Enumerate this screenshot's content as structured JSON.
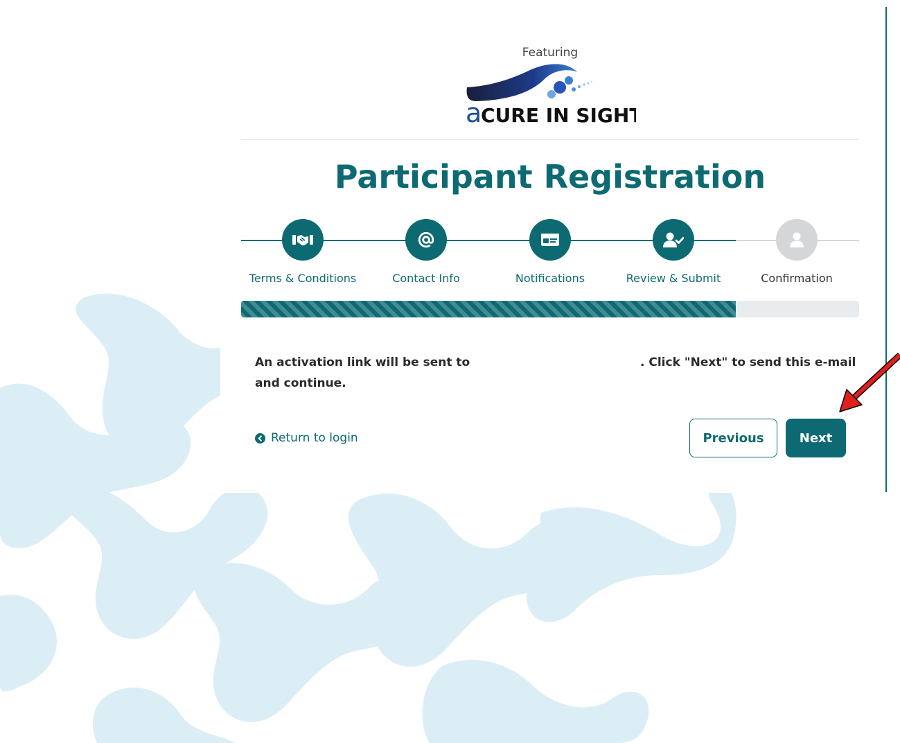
{
  "header": {
    "featuring": "Featuring",
    "brand": "CURE IN SIGHT"
  },
  "page": {
    "title": "Participant Registration"
  },
  "steps": [
    {
      "label": "Terms & Conditions",
      "icon": "handshake-icon",
      "state": "complete"
    },
    {
      "label": "Contact Info",
      "icon": "at-sign-icon",
      "state": "complete"
    },
    {
      "label": "Notifications",
      "icon": "id-card-icon",
      "state": "complete"
    },
    {
      "label": "Review & Submit",
      "icon": "user-check-icon",
      "state": "current"
    },
    {
      "label": "Confirmation",
      "icon": "user-icon",
      "state": "pending"
    }
  ],
  "progress": {
    "percent": 80
  },
  "message": {
    "part1": "An activation link will be sent to",
    "part2": ". Click \"Next\" to send this e-mail",
    "part3": "and continue."
  },
  "nav": {
    "return_label": "Return to login",
    "previous_label": "Previous",
    "next_label": "Next"
  },
  "colors": {
    "primary": "#0d6a72",
    "pending": "#d4d6d8",
    "background_pattern": "#dceef5",
    "annotation_arrow": "#e0201c"
  }
}
